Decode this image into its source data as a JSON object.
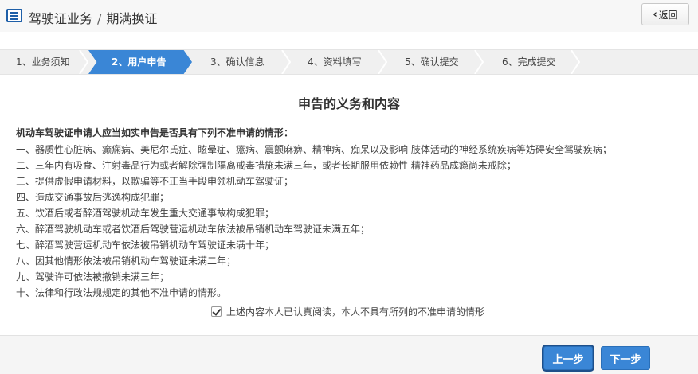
{
  "header": {
    "section": "驾驶证业务",
    "separator": "/",
    "page": "期满换证",
    "back_label": "返回",
    "icon": "list-icon"
  },
  "steps": [
    {
      "label": "1、业务须知",
      "active": false
    },
    {
      "label": "2、用户申告",
      "active": true
    },
    {
      "label": "3、确认信息",
      "active": false
    },
    {
      "label": "4、资料填写",
      "active": false
    },
    {
      "label": "5、确认提交",
      "active": false
    },
    {
      "label": "6、完成提交",
      "active": false
    }
  ],
  "content": {
    "title": "申告的义务和内容",
    "intro": "机动车驾驶证申请人应当如实申告是否具有下列不准申请的情形：",
    "items": [
      "一、器质性心脏病、癫痫病、美尼尔氏症、眩晕症、癔病、震颤麻痹、精神病、痴呆以及影响 肢体活动的神经系统疾病等妨碍安全驾驶疾病；",
      "二、三年内有吸食、注射毒品行为或者解除强制隔离戒毒措施未满三年，或者长期服用依赖性 精神药品成瘾尚未戒除；",
      "三、提供虚假申请材料，以欺骗等不正当手段申领机动车驾驶证；",
      "四、造成交通事故后逃逸构成犯罪；",
      "五、饮酒后或者醉酒驾驶机动车发生重大交通事故构成犯罪；",
      "六、醉酒驾驶机动车或者饮酒后驾驶营运机动车依法被吊销机动车驾驶证未满五年；",
      "七、醉酒驾驶营运机动车依法被吊销机动车驾驶证未满十年；",
      "八、因其他情形依法被吊销机动车驾驶证未满二年；",
      "九、驾驶许可依法被撤销未满三年；",
      "十、法律和行政法规规定的其他不准申请的情形。"
    ],
    "agree_label": "上述内容本人已认真阅读，本人不具有所列的不准申请的情形",
    "agree_checked": true
  },
  "footer": {
    "prev_label": "上一步",
    "next_label": "下一步"
  },
  "colors": {
    "accent": "#3a86d6",
    "header_bg": "#f7f7f7",
    "step_bg": "#f0f0f0"
  }
}
